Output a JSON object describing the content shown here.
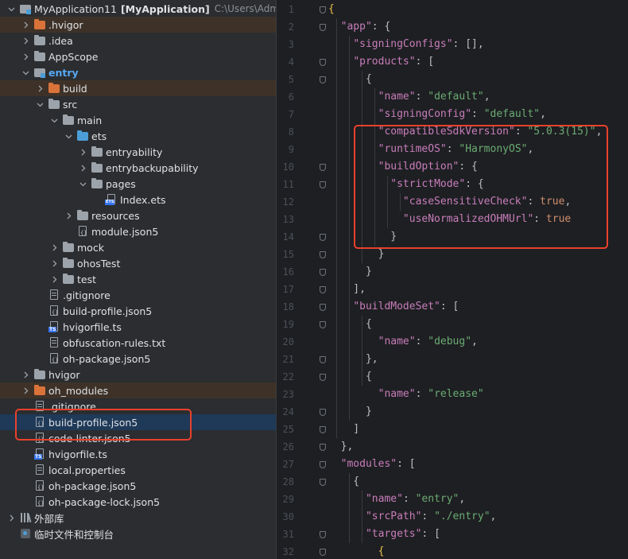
{
  "tree": {
    "rows": [
      {
        "label": "MyApplication11",
        "bold_suffix": "[MyApplication]",
        "hint": "C:\\Users\\Admini",
        "icon": "folder-module-icon",
        "indent": 0,
        "chevron": "down",
        "style": "normal"
      },
      {
        "label": ".hvigor",
        "icon": "folder-excluded-icon",
        "indent": 1,
        "chevron": "right",
        "style": "excluded"
      },
      {
        "label": ".idea",
        "icon": "folder-icon",
        "indent": 1,
        "chevron": "right",
        "style": "normal"
      },
      {
        "label": "AppScope",
        "icon": "folder-icon",
        "indent": 1,
        "chevron": "right",
        "style": "normal"
      },
      {
        "label": "entry",
        "icon": "folder-module-icon",
        "indent": 1,
        "chevron": "down",
        "style": "module"
      },
      {
        "label": "build",
        "icon": "folder-excluded-icon",
        "indent": 2,
        "chevron": "right",
        "style": "excluded"
      },
      {
        "label": "src",
        "icon": "folder-icon",
        "indent": 2,
        "chevron": "down",
        "style": "normal"
      },
      {
        "label": "main",
        "icon": "folder-icon",
        "indent": 3,
        "chevron": "down",
        "style": "normal"
      },
      {
        "label": "ets",
        "icon": "folder-source-icon",
        "indent": 4,
        "chevron": "down",
        "style": "normal"
      },
      {
        "label": "entryability",
        "icon": "folder-icon",
        "indent": 5,
        "chevron": "right",
        "style": "normal"
      },
      {
        "label": "entrybackupability",
        "icon": "folder-icon",
        "indent": 5,
        "chevron": "right",
        "style": "normal"
      },
      {
        "label": "pages",
        "icon": "folder-icon",
        "indent": 5,
        "chevron": "down",
        "style": "normal"
      },
      {
        "label": "Index.ets",
        "icon": "ets-file-icon",
        "indent": 6,
        "chevron": "none",
        "style": "normal"
      },
      {
        "label": "resources",
        "icon": "folder-icon",
        "indent": 4,
        "chevron": "right",
        "style": "normal"
      },
      {
        "label": "module.json5",
        "icon": "json-file-icon",
        "indent": 4,
        "chevron": "none",
        "style": "normal"
      },
      {
        "label": "mock",
        "icon": "folder-icon",
        "indent": 3,
        "chevron": "right",
        "style": "normal"
      },
      {
        "label": "ohosTest",
        "icon": "folder-icon",
        "indent": 3,
        "chevron": "right",
        "style": "normal"
      },
      {
        "label": "test",
        "icon": "folder-icon",
        "indent": 3,
        "chevron": "right",
        "style": "normal"
      },
      {
        "label": ".gitignore",
        "icon": "text-file-icon",
        "indent": 2,
        "chevron": "none",
        "style": "normal"
      },
      {
        "label": "build-profile.json5",
        "icon": "json-file-icon",
        "indent": 2,
        "chevron": "none",
        "style": "normal"
      },
      {
        "label": "hvigorfile.ts",
        "icon": "ts-file-icon",
        "indent": 2,
        "chevron": "none",
        "style": "normal"
      },
      {
        "label": "obfuscation-rules.txt",
        "icon": "text-file-icon",
        "indent": 2,
        "chevron": "none",
        "style": "normal"
      },
      {
        "label": "oh-package.json5",
        "icon": "json-file-icon",
        "indent": 2,
        "chevron": "none",
        "style": "normal"
      },
      {
        "label": "hvigor",
        "icon": "folder-icon",
        "indent": 1,
        "chevron": "right",
        "style": "normal"
      },
      {
        "label": "oh_modules",
        "icon": "folder-excluded-icon",
        "indent": 1,
        "chevron": "right",
        "style": "excluded"
      },
      {
        "label": ".gitignore",
        "icon": "text-file-icon",
        "indent": 1,
        "chevron": "none",
        "style": "normal"
      },
      {
        "label": "build-profile.json5",
        "icon": "json-file-icon",
        "indent": 1,
        "chevron": "none",
        "style": "selected"
      },
      {
        "label": "code-linter.json5",
        "icon": "json-file-icon",
        "indent": 1,
        "chevron": "none",
        "style": "normal"
      },
      {
        "label": "hvigorfile.ts",
        "icon": "ts-file-icon",
        "indent": 1,
        "chevron": "none",
        "style": "normal"
      },
      {
        "label": "local.properties",
        "icon": "text-file-icon",
        "indent": 1,
        "chevron": "none",
        "style": "normal"
      },
      {
        "label": "oh-package.json5",
        "icon": "json-file-icon",
        "indent": 1,
        "chevron": "none",
        "style": "normal"
      },
      {
        "label": "oh-package-lock.json5",
        "icon": "json-file-icon",
        "indent": 1,
        "chevron": "none",
        "style": "normal"
      },
      {
        "label": "外部库",
        "icon": "library-icon",
        "indent": 0,
        "chevron": "right",
        "style": "normal"
      },
      {
        "label": "临时文件和控制台",
        "icon": "console-icon",
        "indent": 0,
        "chevron": "none",
        "style": "normal"
      }
    ]
  },
  "editor": {
    "lines": [
      [
        [
          "brk-y",
          "{"
        ]
      ],
      [
        [
          "p",
          "  "
        ],
        [
          "key",
          "\"app\""
        ],
        [
          "p",
          ": {"
        ]
      ],
      [
        [
          "p",
          "    "
        ],
        [
          "key",
          "\"signingConfigs\""
        ],
        [
          "p",
          ": [],"
        ]
      ],
      [
        [
          "p",
          "    "
        ],
        [
          "key",
          "\"products\""
        ],
        [
          "p",
          ": ["
        ]
      ],
      [
        [
          "p",
          "      {"
        ]
      ],
      [
        [
          "p",
          "        "
        ],
        [
          "key",
          "\"name\""
        ],
        [
          "p",
          ": "
        ],
        [
          "str",
          "\"default\""
        ],
        [
          "p",
          ","
        ]
      ],
      [
        [
          "p",
          "        "
        ],
        [
          "key",
          "\"signingConfig\""
        ],
        [
          "p",
          ": "
        ],
        [
          "str",
          "\"default\""
        ],
        [
          "p",
          ","
        ]
      ],
      [
        [
          "p",
          "        "
        ],
        [
          "key",
          "\"compatibleSdkVersion\""
        ],
        [
          "p",
          ": "
        ],
        [
          "str",
          "\"5.0.3(15)\""
        ],
        [
          "p",
          ","
        ]
      ],
      [
        [
          "p",
          "        "
        ],
        [
          "key",
          "\"runtimeOS\""
        ],
        [
          "p",
          ": "
        ],
        [
          "str",
          "\"HarmonyOS\""
        ],
        [
          "p",
          ","
        ]
      ],
      [
        [
          "p",
          "        "
        ],
        [
          "key",
          "\"buildOption\""
        ],
        [
          "p",
          ": {"
        ]
      ],
      [
        [
          "p",
          "          "
        ],
        [
          "key",
          "\"strictMode\""
        ],
        [
          "p",
          ": {"
        ]
      ],
      [
        [
          "p",
          "            "
        ],
        [
          "key",
          "\"caseSensitiveCheck\""
        ],
        [
          "p",
          ": "
        ],
        [
          "kw",
          "true"
        ],
        [
          "p",
          ","
        ]
      ],
      [
        [
          "p",
          "            "
        ],
        [
          "key",
          "\"useNormalizedOHMUrl\""
        ],
        [
          "p",
          ": "
        ],
        [
          "kw",
          "true"
        ]
      ],
      [
        [
          "p",
          "          }"
        ]
      ],
      [
        [
          "p",
          "        }"
        ]
      ],
      [
        [
          "p",
          "      }"
        ]
      ],
      [
        [
          "p",
          "    ],"
        ]
      ],
      [
        [
          "p",
          "    "
        ],
        [
          "key",
          "\"buildModeSet\""
        ],
        [
          "p",
          ": ["
        ]
      ],
      [
        [
          "p",
          "      {"
        ]
      ],
      [
        [
          "p",
          "        "
        ],
        [
          "key",
          "\"name\""
        ],
        [
          "p",
          ": "
        ],
        [
          "str",
          "\"debug\""
        ],
        [
          "p",
          ","
        ]
      ],
      [
        [
          "p",
          "      },"
        ]
      ],
      [
        [
          "p",
          "      {"
        ]
      ],
      [
        [
          "p",
          "        "
        ],
        [
          "key",
          "\"name\""
        ],
        [
          "p",
          ": "
        ],
        [
          "str",
          "\"release\""
        ]
      ],
      [
        [
          "p",
          "      }"
        ]
      ],
      [
        [
          "p",
          "    ]"
        ]
      ],
      [
        [
          "p",
          "  },"
        ]
      ],
      [
        [
          "p",
          "  "
        ],
        [
          "key",
          "\"modules\""
        ],
        [
          "p",
          ": ["
        ]
      ],
      [
        [
          "p",
          "    {"
        ]
      ],
      [
        [
          "p",
          "      "
        ],
        [
          "key",
          "\"name\""
        ],
        [
          "p",
          ": "
        ],
        [
          "str",
          "\"entry\""
        ],
        [
          "p",
          ","
        ]
      ],
      [
        [
          "p",
          "      "
        ],
        [
          "key",
          "\"srcPath\""
        ],
        [
          "p",
          ": "
        ],
        [
          "str",
          "\"./entry\""
        ],
        [
          "p",
          ","
        ]
      ],
      [
        [
          "p",
          "      "
        ],
        [
          "key",
          "\"targets\""
        ],
        [
          "p",
          ": ["
        ]
      ],
      [
        [
          "p",
          "        "
        ],
        [
          "brk-y",
          "{"
        ]
      ]
    ],
    "line_numbers": [
      "1",
      "2",
      "3",
      "4",
      "5",
      "6",
      "7",
      "8",
      "9",
      "10",
      "11",
      "12",
      "13",
      "14",
      "15",
      "16",
      "17",
      "18",
      "19",
      "20",
      "21",
      "22",
      "23",
      "24",
      "25",
      "26",
      "27",
      "28",
      "29",
      "30",
      "31",
      "32"
    ],
    "fold_markers": [
      1,
      2,
      4,
      5,
      10,
      11,
      14,
      15,
      16,
      17,
      18,
      19,
      21,
      22,
      24,
      25,
      26,
      27,
      28,
      31,
      32
    ]
  },
  "colors": {
    "annotation_box": "#e8412c",
    "json_key": "#c77dbb",
    "json_string": "#6aab73",
    "json_keyword": "#cf8e6d",
    "selection": "#1f3a58"
  }
}
